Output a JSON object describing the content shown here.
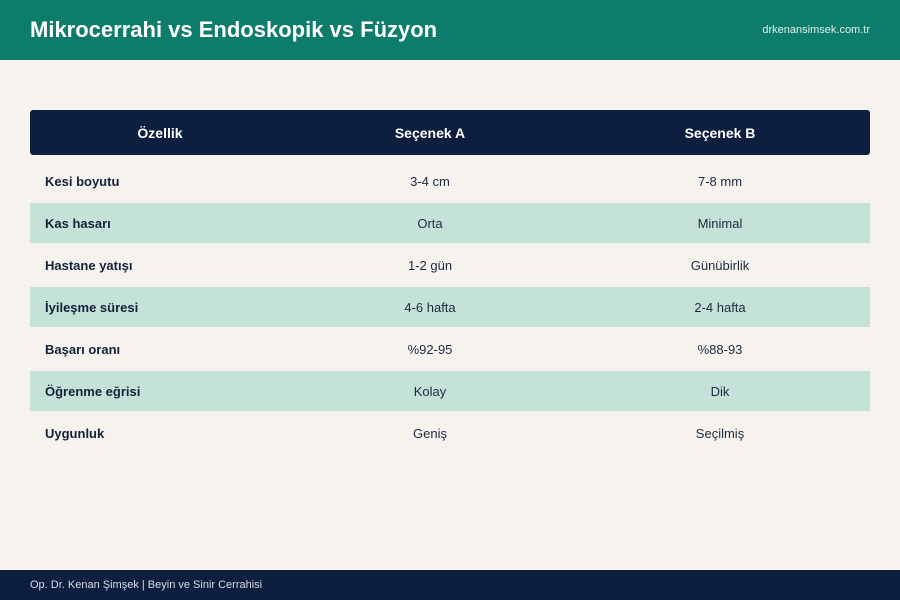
{
  "header": {
    "title": "Mikrocerrahi vs Endoskopik vs Füzyon",
    "site": "drkenansimsek.com.tr"
  },
  "table": {
    "columns": [
      "Özellik",
      "Seçenek A",
      "Seçenek B"
    ],
    "rows": [
      {
        "label": "Kesi boyutu",
        "a": "3-4 cm",
        "b": "7-8 mm"
      },
      {
        "label": "Kas hasarı",
        "a": "Orta",
        "b": "Minimal"
      },
      {
        "label": "Hastane yatışı",
        "a": "1-2 gün",
        "b": "Günübirlik"
      },
      {
        "label": "İyileşme süresi",
        "a": "4-6 hafta",
        "b": "2-4 hafta"
      },
      {
        "label": "Başarı oranı",
        "a": "%92-95",
        "b": "%88-93"
      },
      {
        "label": "Öğrenme eğrisi",
        "a": "Kolay",
        "b": "Dik"
      },
      {
        "label": "Uygunluk",
        "a": "Geniş",
        "b": "Seçilmiş"
      }
    ]
  },
  "footer": {
    "text": "Op. Dr. Kenan Şimşek | Beyin ve Sinir Cerrahisi"
  }
}
